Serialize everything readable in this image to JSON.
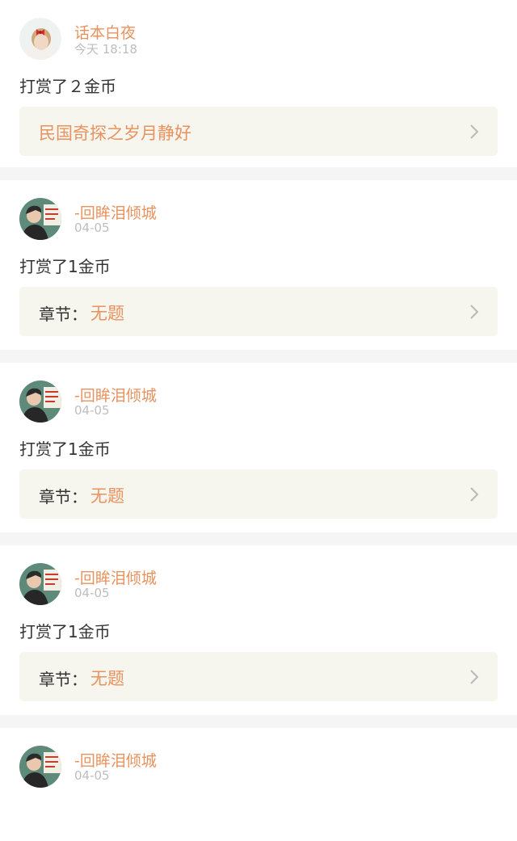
{
  "feed": {
    "items": [
      {
        "username": "话本白夜",
        "time": "今天 18:18",
        "reward": "打赏了２金币",
        "card": {
          "label": "",
          "value": "民国奇探之岁月静好"
        },
        "avatar_icon": "girl-avatar-icon"
      },
      {
        "username": "-回眸泪倾城",
        "time": "04-05",
        "reward": "打赏了1金币",
        "card": {
          "label": "章节：",
          "value": "无题"
        },
        "avatar_icon": "boy-avatar-icon"
      },
      {
        "username": "-回眸泪倾城",
        "time": "04-05",
        "reward": "打赏了1金币",
        "card": {
          "label": "章节：",
          "value": "无题"
        },
        "avatar_icon": "boy-avatar-icon"
      },
      {
        "username": "-回眸泪倾城",
        "time": "04-05",
        "reward": "打赏了1金币",
        "card": {
          "label": "章节：",
          "value": "无题"
        },
        "avatar_icon": "boy-avatar-icon"
      },
      {
        "username": "-回眸泪倾城",
        "time": "04-05",
        "avatar_icon": "boy-avatar-icon"
      }
    ]
  },
  "colors": {
    "accent": "#e8925e",
    "text": "#333333",
    "muted": "#bdbdbd",
    "card_bg": "#f6f5ee",
    "separator": "#f5f5f5",
    "chevron": "#b9b9b9"
  }
}
